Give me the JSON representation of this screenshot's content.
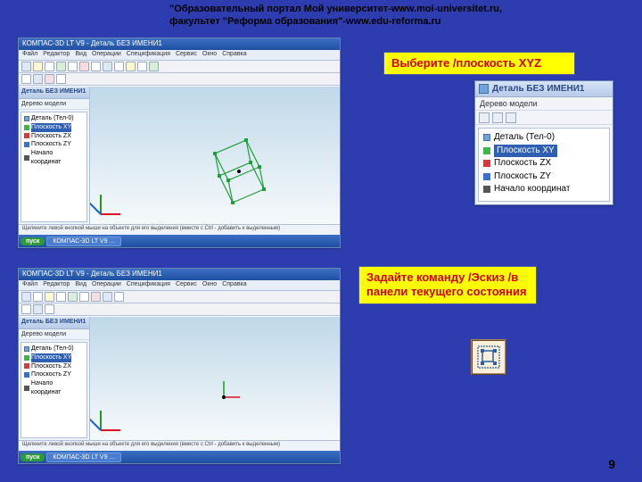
{
  "header": {
    "line1": "\"Образовательный портал Мой университет-www.moi-universitet.ru,",
    "line2": "факультет \"Реформа образования\"-www.edu-reforma.ru"
  },
  "callout1": "Выберите /плоскость  XYZ",
  "callout2": "Задайте команду /Эскиз /в панели текущего состояния",
  "page_number": "9",
  "app": {
    "title": "КОМПАС-3D LT V9 - Деталь БЕЗ ИМЕНИ1",
    "menu": [
      "Файл",
      "Редактор",
      "Вид",
      "Операции",
      "Спецификация",
      "Сервис",
      "Окно",
      "Справка"
    ],
    "status_top": "Щелкните левой кнопкой мыши на объекте для его выделения (вместе с Ctrl - добавить к выделенным)",
    "status_bot": "Щелкните левой кнопкой мыши на объекте для его выделения (вместе с Ctrl - добавить к выделенным)",
    "taskbar_start": "пуск",
    "taskbar_task": "КОМПАС-3D LT V9 …"
  },
  "tree": {
    "panel_title": "Деталь БЕЗ ИМЕНИ1",
    "sub": "Дерево модели",
    "root": "Деталь (Тел-0)",
    "items": [
      {
        "color": "green",
        "label": "Плоскость XY",
        "selected": true
      },
      {
        "color": "red",
        "label": "Плоскость ZX",
        "selected": false
      },
      {
        "color": "blue",
        "label": "Плоскость ZY",
        "selected": false
      },
      {
        "color": "star",
        "label": "Начало координат",
        "selected": false
      }
    ]
  },
  "sketch_icon_name": "sketch-icon"
}
